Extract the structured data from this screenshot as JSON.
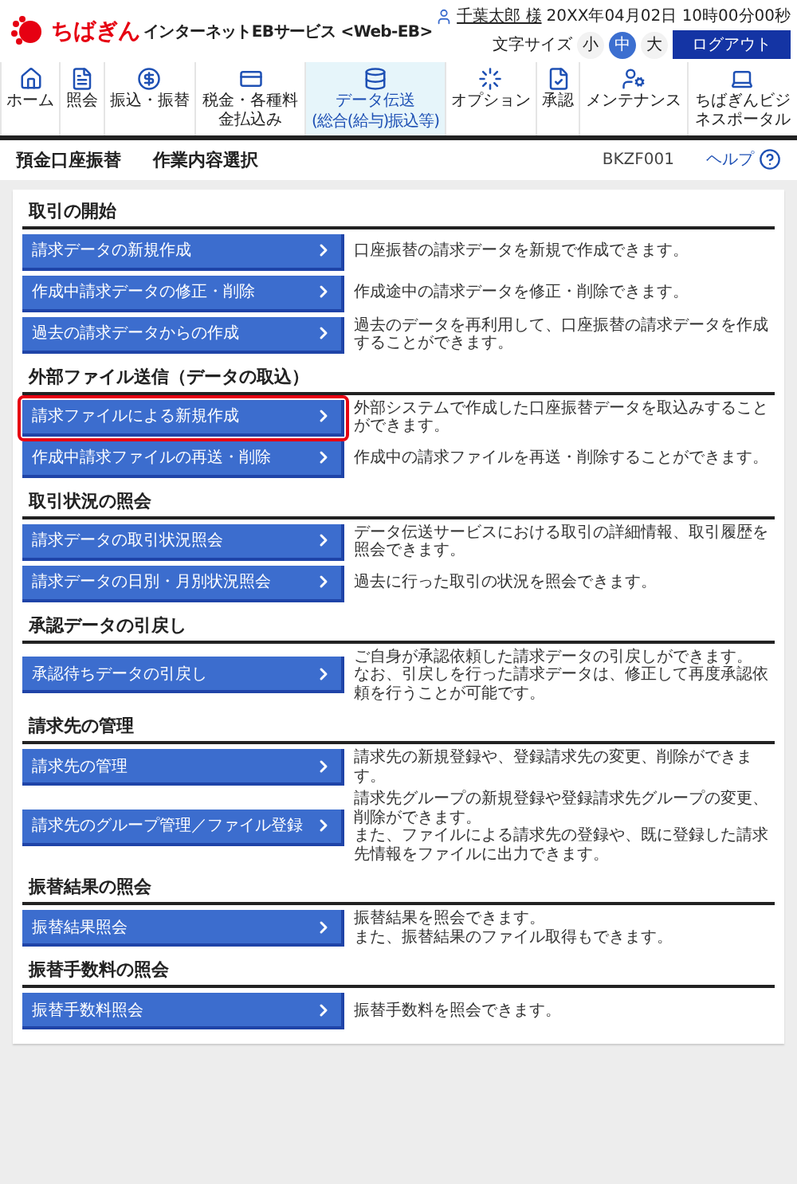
{
  "header": {
    "brand": "ちばぎん",
    "service": "インターネットEBサービス <Web-EB>",
    "user": "千葉太郎 様",
    "datetime": "20XX年04月02日 10時00分00秒",
    "font_size_label": "文字サイズ",
    "font_sizes": [
      {
        "label": "小",
        "selected": false
      },
      {
        "label": "中",
        "selected": true
      },
      {
        "label": "大",
        "selected": false
      }
    ],
    "logout": "ログアウト"
  },
  "nav": [
    {
      "kind": "home",
      "label": "ホーム",
      "selected": false
    },
    {
      "kind": "inquiry",
      "label": "照会",
      "selected": false
    },
    {
      "kind": "transfer",
      "label": "振込・振替",
      "selected": false
    },
    {
      "kind": "tax",
      "label": "税金・各種料金払込み",
      "selected": false
    },
    {
      "kind": "data",
      "label": "データ伝送",
      "sub": "(総合(給与)振込等)",
      "selected": true
    },
    {
      "kind": "option",
      "label": "オプション",
      "selected": false
    },
    {
      "kind": "approve",
      "label": "承認",
      "selected": false
    },
    {
      "kind": "maintenance",
      "label": "メンテナンス",
      "selected": false
    },
    {
      "kind": "portal",
      "label": "ちばぎんビジネスポータル",
      "selected": false
    }
  ],
  "title_bar": {
    "category": "預金口座振替",
    "title": "作業内容選択",
    "screen_id": "BKZF001",
    "help": "ヘルプ"
  },
  "sections": [
    {
      "heading": "取引の開始",
      "items": [
        {
          "button": "請求データの新規作成",
          "description": "口座振替の請求データを新規で作成できます。",
          "highlighted": false
        },
        {
          "button": "作成中請求データの修正・削除",
          "description": "作成途中の請求データを修正・削除できます。",
          "highlighted": false
        },
        {
          "button": "過去の請求データからの作成",
          "description": "過去のデータを再利用して、口座振替の請求データを作成することができます。",
          "highlighted": false
        }
      ]
    },
    {
      "heading": "外部ファイル送信（データの取込）",
      "items": [
        {
          "button": "請求ファイルによる新規作成",
          "description": "外部システムで作成した口座振替データを取込みすることができます。",
          "highlighted": true
        },
        {
          "button": "作成中請求ファイルの再送・削除",
          "description": "作成中の請求ファイルを再送・削除することができます。",
          "highlighted": false
        }
      ]
    },
    {
      "heading": "取引状況の照会",
      "items": [
        {
          "button": "請求データの取引状況照会",
          "description": "データ伝送サービスにおける取引の詳細情報、取引履歴を照会できます。",
          "highlighted": false
        },
        {
          "button": "請求データの日別・月別状況照会",
          "description": "過去に行った取引の状況を照会できます。",
          "highlighted": false
        }
      ]
    },
    {
      "heading": "承認データの引戻し",
      "items": [
        {
          "button": "承認待ちデータの引戻し",
          "description": "ご自身が承認依頼した請求データの引戻しができます。",
          "description_2": "なお、引戻しを行った請求データは、修正して再度承認依頼を行うことが可能です。",
          "highlighted": false
        }
      ]
    },
    {
      "heading": "請求先の管理",
      "items": [
        {
          "button": "請求先の管理",
          "description": "請求先の新規登録や、登録請求先の変更、削除ができます。",
          "highlighted": false
        },
        {
          "button": "請求先のグループ管理／ファイル登録",
          "description": "請求先グループの新規登録や登録請求先グループの変更、削除ができます。",
          "description_2": "また、ファイルによる請求先の登録や、既に登録した請求先情報をファイルに出力できます。",
          "highlighted": false
        }
      ]
    },
    {
      "heading": "振替結果の照会",
      "items": [
        {
          "button": "振替結果照会",
          "description": "振替結果を照会できます。",
          "description_2": "また、振替結果のファイル取得もできます。",
          "highlighted": false
        }
      ]
    },
    {
      "heading": "振替手数料の照会",
      "items": [
        {
          "button": "振替手数料照会",
          "description": "振替手数料を照会できます。",
          "highlighted": false
        }
      ]
    }
  ]
}
